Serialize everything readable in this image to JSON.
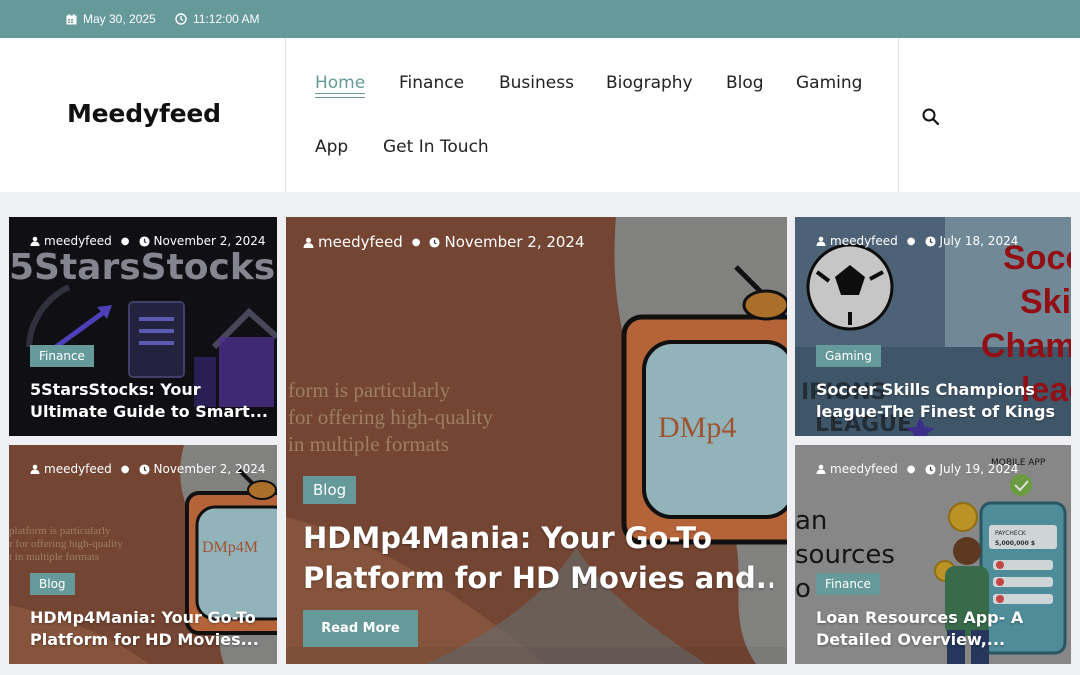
{
  "topbar": {
    "date": "May 30, 2025",
    "time": "11:12:00 AM"
  },
  "header": {
    "logo": "Meedyfeed",
    "nav": [
      "Home",
      "Finance",
      "Business",
      "Biography",
      "Blog",
      "Gaming",
      "App",
      "Get In Touch"
    ],
    "active_nav": "Home"
  },
  "cards": [
    {
      "author": "meedyfeed",
      "date": "November 2, 2024",
      "category": "Finance",
      "title_lines": [
        "5StarsStocks: Your",
        "Ultimate Guide to Smart..."
      ],
      "image_text": "5StarsStocks"
    },
    {
      "author": "meedyfeed",
      "date": "November 2, 2024",
      "category": "Blog",
      "title_lines": [
        "HDMp4Mania: Your Go-To",
        "Platform for HD Movies and..."
      ],
      "read_more": "Read More",
      "image_text_lines": [
        "form is particularly",
        "for offering high-quality",
        "in multiple formats"
      ],
      "image_logo": "DMp4"
    },
    {
      "author": "meedyfeed",
      "date": "July 18, 2024",
      "category": "Gaming",
      "title_lines": [
        "Soccer Skills Champions",
        "league-The Finest of Kings"
      ],
      "image_text_lines": [
        "Soccer",
        "Skills",
        "Champio",
        "league"
      ]
    },
    {
      "author": "meedyfeed",
      "date": "November 2, 2024",
      "category": "Blog",
      "title_lines": [
        "HDMp4Mania: Your Go-To",
        "Platform for HD Movies..."
      ],
      "image_text_lines": [
        "platform is particularly",
        "r for offering high-quality",
        "t in multiple formats"
      ],
      "image_logo": "DMp4M"
    },
    {
      "author": "meedyfeed",
      "date": "July 19, 2024",
      "category": "Finance",
      "title_lines": [
        "Loan Resources App- A",
        "Detailed Overview,..."
      ],
      "image_text_lines": [
        "an",
        "sources",
        "o"
      ],
      "image_labels": [
        "MOBILE APP",
        "PAYCHECK",
        "5,000,000 $"
      ]
    }
  ],
  "colors": {
    "accent": "#65999a",
    "hdmp4_brown": "#7b4a36",
    "hdmp4_orange": "#c16a3c"
  },
  "icons": [
    "calendar-icon",
    "clock-icon",
    "search-icon",
    "user-icon"
  ]
}
